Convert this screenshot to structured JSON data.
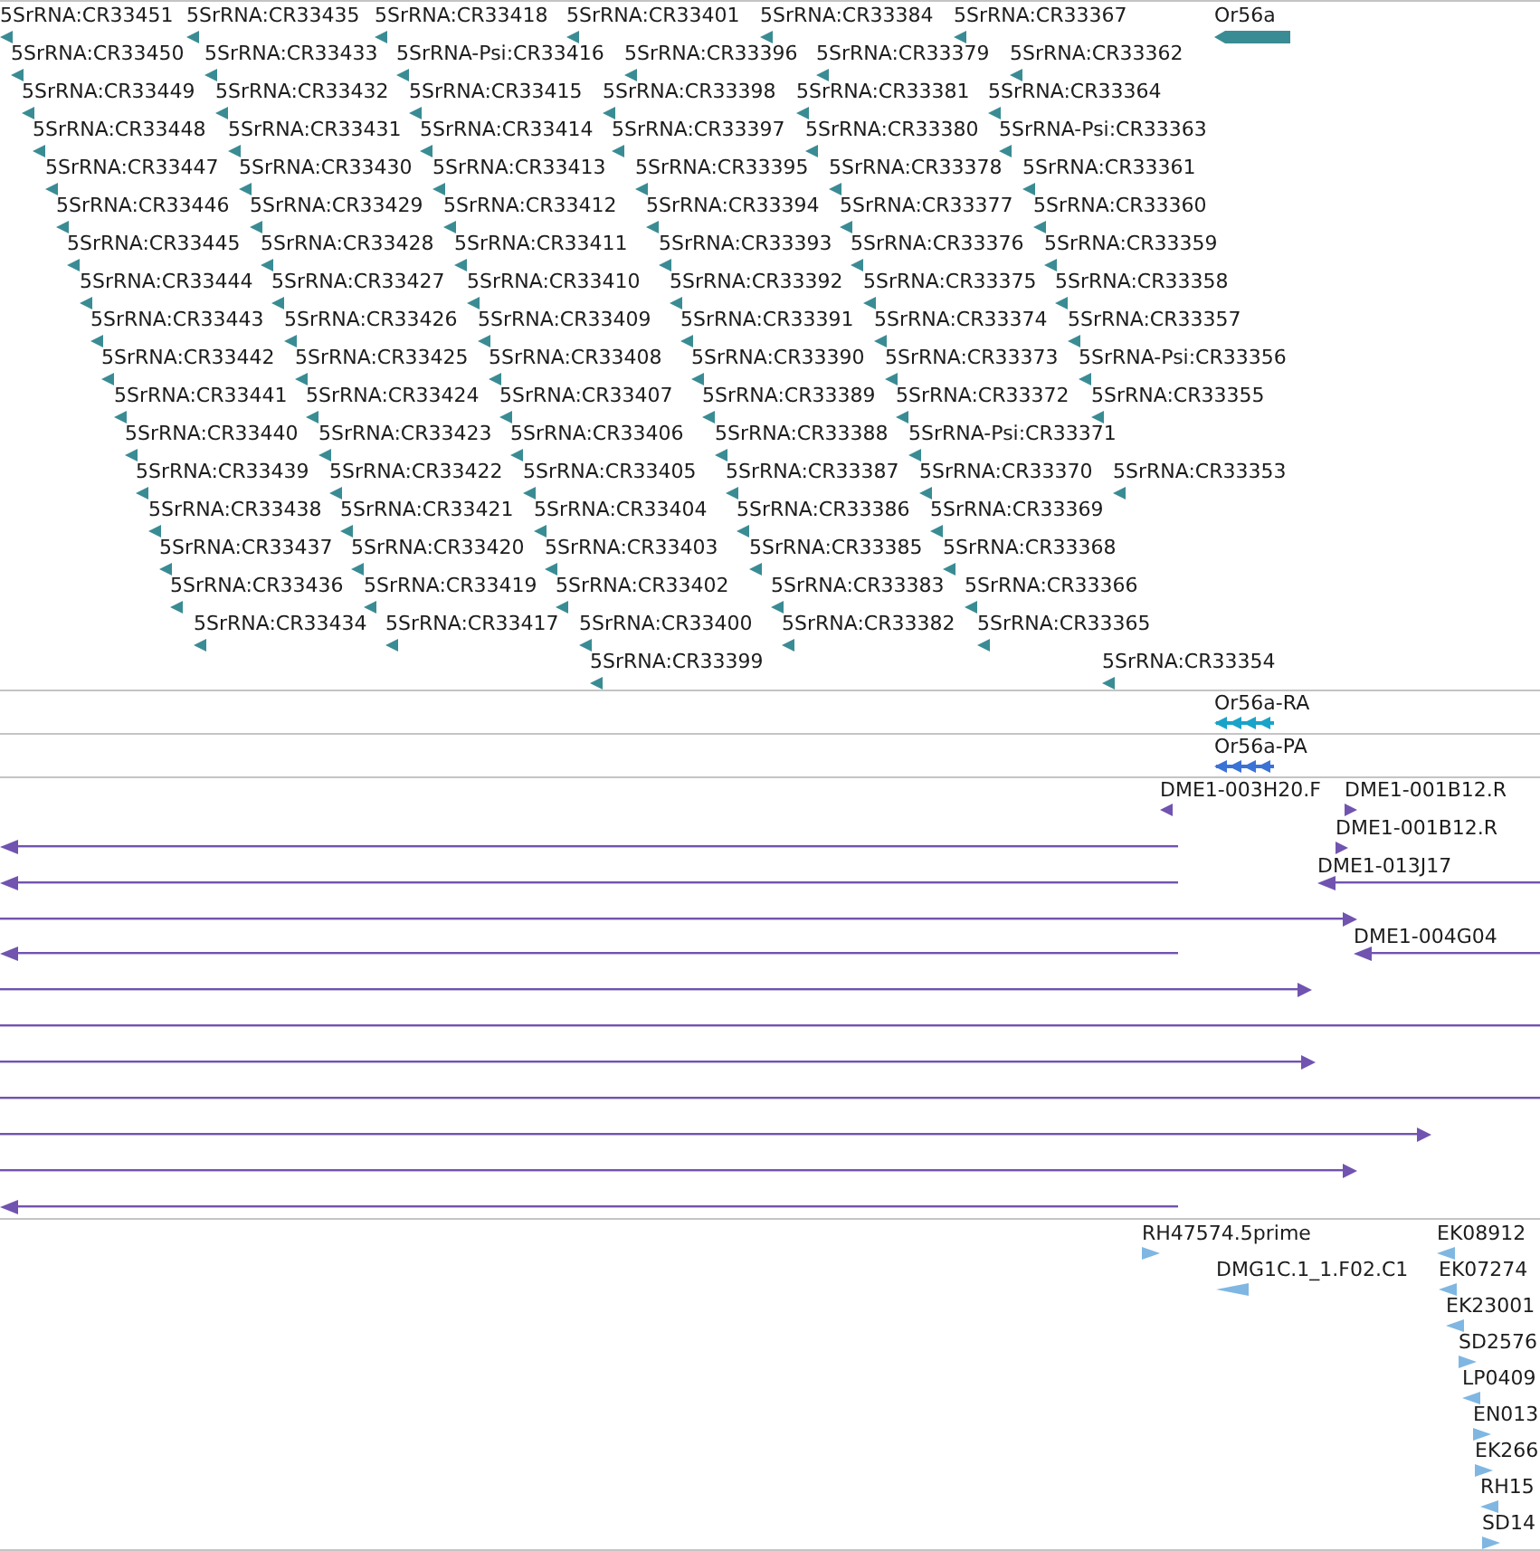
{
  "features_track": {
    "rows": [
      [
        "5SrRNA:CR33451",
        "5SrRNA:CR33435",
        "5SrRNA:CR33418",
        "5SrRNA:CR33401",
        "5SrRNA:CR33384",
        "5SrRNA:CR33367"
      ],
      [
        "5SrRNA:CR33450",
        "5SrRNA:CR33433",
        "5SrRNA-Psi:CR33416",
        "5SrRNA:CR33396",
        "5SrRNA:CR33379",
        "5SrRNA:CR33362"
      ],
      [
        "5SrRNA:CR33449",
        "5SrRNA:CR33432",
        "5SrRNA:CR33415",
        "5SrRNA:CR33398",
        "5SrRNA:CR33381",
        "5SrRNA:CR33364"
      ],
      [
        "5SrRNA:CR33448",
        "5SrRNA:CR33431",
        "5SrRNA:CR33414",
        "5SrRNA:CR33397",
        "5SrRNA:CR33380",
        "5SrRNA-Psi:CR33363"
      ],
      [
        "5SrRNA:CR33447",
        "5SrRNA:CR33430",
        "5SrRNA:CR33413",
        "5SrRNA:CR33395",
        "5SrRNA:CR33378",
        "5SrRNA:CR33361"
      ],
      [
        "5SrRNA:CR33446",
        "5SrRNA:CR33429",
        "5SrRNA:CR33412",
        "5SrRNA:CR33394",
        "5SrRNA:CR33377",
        "5SrRNA:CR33360"
      ],
      [
        "5SrRNA:CR33445",
        "5SrRNA:CR33428",
        "5SrRNA:CR33411",
        "5SrRNA:CR33393",
        "5SrRNA:CR33376",
        "5SrRNA:CR33359"
      ],
      [
        "5SrRNA:CR33444",
        "5SrRNA:CR33427",
        "5SrRNA:CR33410",
        "5SrRNA:CR33392",
        "5SrRNA:CR33375",
        "5SrRNA:CR33358"
      ],
      [
        "5SrRNA:CR33443",
        "5SrRNA:CR33426",
        "5SrRNA:CR33409",
        "5SrRNA:CR33391",
        "5SrRNA:CR33374",
        "5SrRNA:CR33357"
      ],
      [
        "5SrRNA:CR33442",
        "5SrRNA:CR33425",
        "5SrRNA:CR33408",
        "5SrRNA:CR33390",
        "5SrRNA:CR33373",
        "5SrRNA-Psi:CR33356"
      ],
      [
        "5SrRNA:CR33441",
        "5SrRNA:CR33424",
        "5SrRNA:CR33407",
        "5SrRNA:CR33389",
        "5SrRNA:CR33372",
        "5SrRNA:CR33355"
      ],
      [
        "5SrRNA:CR33440",
        "5SrRNA:CR33423",
        "5SrRNA:CR33406",
        "5SrRNA:CR33388",
        "5SrRNA-Psi:CR33371"
      ],
      [
        "5SrRNA:CR33439",
        "5SrRNA:CR33422",
        "5SrRNA:CR33405",
        "5SrRNA:CR33387",
        "5SrRNA:CR33370",
        "5SrRNA:CR33353"
      ],
      [
        "5SrRNA:CR33438",
        "5SrRNA:CR33421",
        "5SrRNA:CR33404",
        "5SrRNA:CR33386",
        "5SrRNA:CR33369"
      ],
      [
        "5SrRNA:CR33437",
        "5SrRNA:CR33420",
        "5SrRNA:CR33403",
        "5SrRNA:CR33385",
        "5SrRNA:CR33368"
      ],
      [
        "5SrRNA:CR33436",
        "5SrRNA:CR33419",
        "5SrRNA:CR33402",
        "5SrRNA:CR33383",
        "5SrRNA:CR33366"
      ],
      [
        "5SrRNA:CR33434",
        "5SrRNA:CR33417",
        "5SrRNA:CR33400",
        "5SrRNA:CR33382",
        "5SrRNA:CR33365"
      ],
      [
        "5SrRNA:CR33399",
        "5SrRNA:CR33354"
      ]
    ],
    "gene": {
      "label": "Or56a",
      "reverse": true
    }
  },
  "transcript_tracks": [
    {
      "label": "Or56a-RA",
      "color": "#19a3c9"
    },
    {
      "label": "Or56a-PA",
      "color": "#3b72d6"
    }
  ],
  "clone_track": {
    "features": [
      {
        "label": "DME1-003H20.F",
        "reverse": true
      },
      {
        "label": "DME1-001B12.R",
        "reverse": false
      },
      {
        "label": "DME1-001B12.R",
        "reverse": false
      },
      {
        "label": "DME1-013J17",
        "reverse": true
      },
      {
        "label": "DME1-004G04",
        "reverse": true
      }
    ]
  },
  "est_track": {
    "features": [
      {
        "label": "RH47574.5prime",
        "reverse": false
      },
      {
        "label": "DMG1C.1_1.F02.C1",
        "reverse": true
      },
      {
        "label": "EK08912",
        "reverse": true
      },
      {
        "label": "EK07274",
        "reverse": true
      },
      {
        "label": "EK23001",
        "reverse": true
      },
      {
        "label": "SD2576",
        "reverse": false
      },
      {
        "label": "LP0409",
        "reverse": true
      },
      {
        "label": "EN013",
        "reverse": false
      },
      {
        "label": "EK266",
        "reverse": false
      },
      {
        "label": "RH15",
        "reverse": true
      },
      {
        "label": "SD14",
        "reverse": false
      }
    ]
  }
}
